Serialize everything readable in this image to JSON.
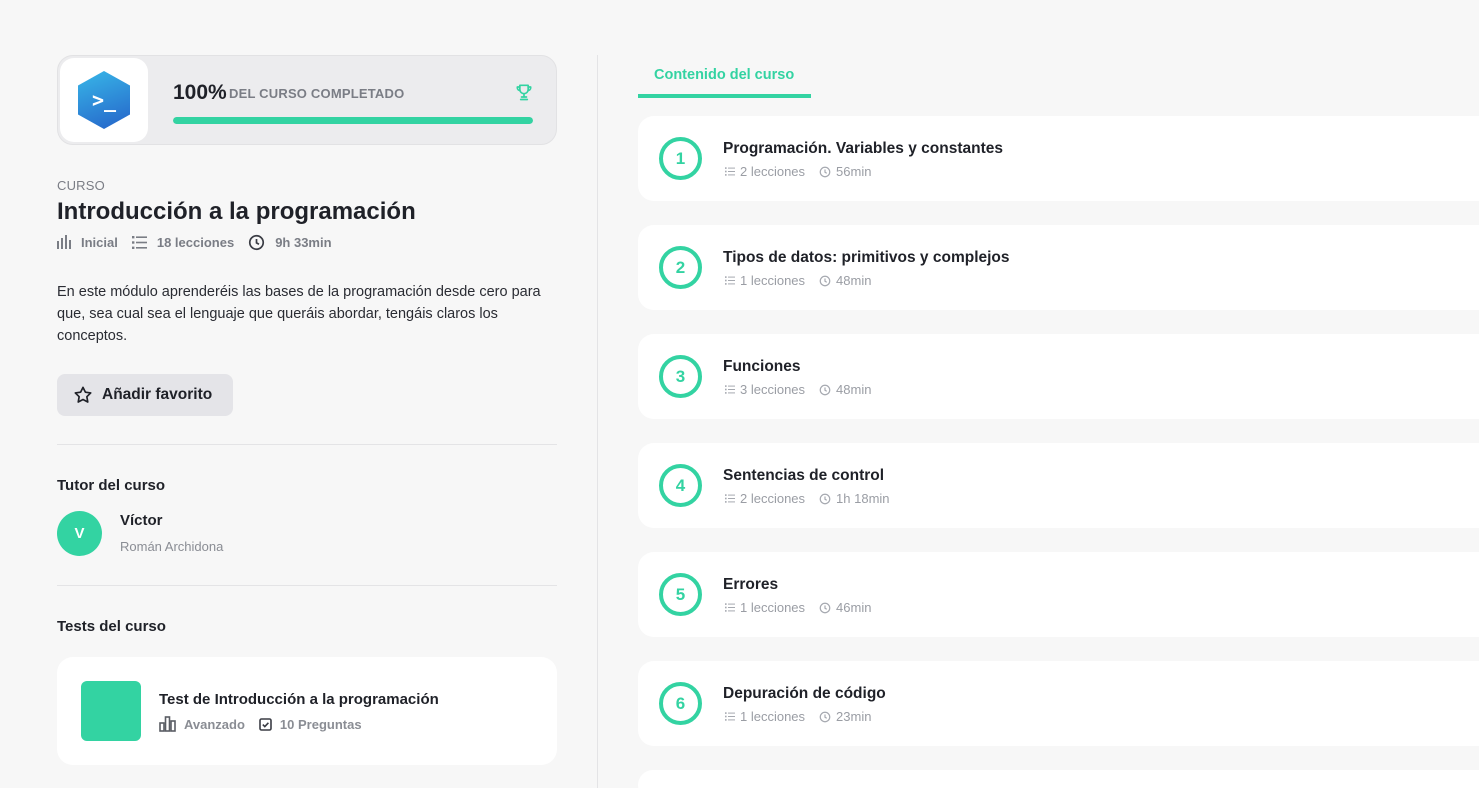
{
  "progress": {
    "percent_text": "100%",
    "label": "DEL CURSO COMPLETADO",
    "fraction": 1.0,
    "logo_glyph": ">_"
  },
  "course": {
    "eyebrow": "CURSO",
    "title": "Introducción a la programación",
    "level": "Inicial",
    "lessons": "18 lecciones",
    "duration": "9h 33min",
    "description": "En este módulo aprenderéis las bases de la programación desde cero para que, sea cual sea el lenguaje que queráis abordar, tengáis claros los conceptos."
  },
  "favorite_button": {
    "label": "Añadir favorito",
    "icon": "star-icon"
  },
  "tutor": {
    "section_title": "Tutor del curso",
    "initial": "V",
    "name": "Víctor",
    "surname": "Román Archidona"
  },
  "tests": {
    "section_title": "Tests del curso",
    "items": [
      {
        "title": "Test de Introducción a la programación",
        "level": "Avanzado",
        "questions": "10 Preguntas"
      }
    ]
  },
  "tabs": {
    "active": "Contenido del curso"
  },
  "modules": [
    {
      "number": "1",
      "title": "Programación. Variables y constantes",
      "lessons": "2 lecciones",
      "duration": "56min"
    },
    {
      "number": "2",
      "title": "Tipos de datos: primitivos y complejos",
      "lessons": "1 lecciones",
      "duration": "48min"
    },
    {
      "number": "3",
      "title": "Funciones",
      "lessons": "3 lecciones",
      "duration": "48min"
    },
    {
      "number": "4",
      "title": "Sentencias de control",
      "lessons": "2 lecciones",
      "duration": "1h 18min"
    },
    {
      "number": "5",
      "title": "Errores",
      "lessons": "1 lecciones",
      "duration": "46min"
    },
    {
      "number": "6",
      "title": "Depuración de código",
      "lessons": "1 lecciones",
      "duration": "23min"
    }
  ],
  "colors": {
    "accent": "#33d3a2",
    "text": "#1f2128",
    "muted": "#7a7d85",
    "background": "#f7f7f7"
  }
}
